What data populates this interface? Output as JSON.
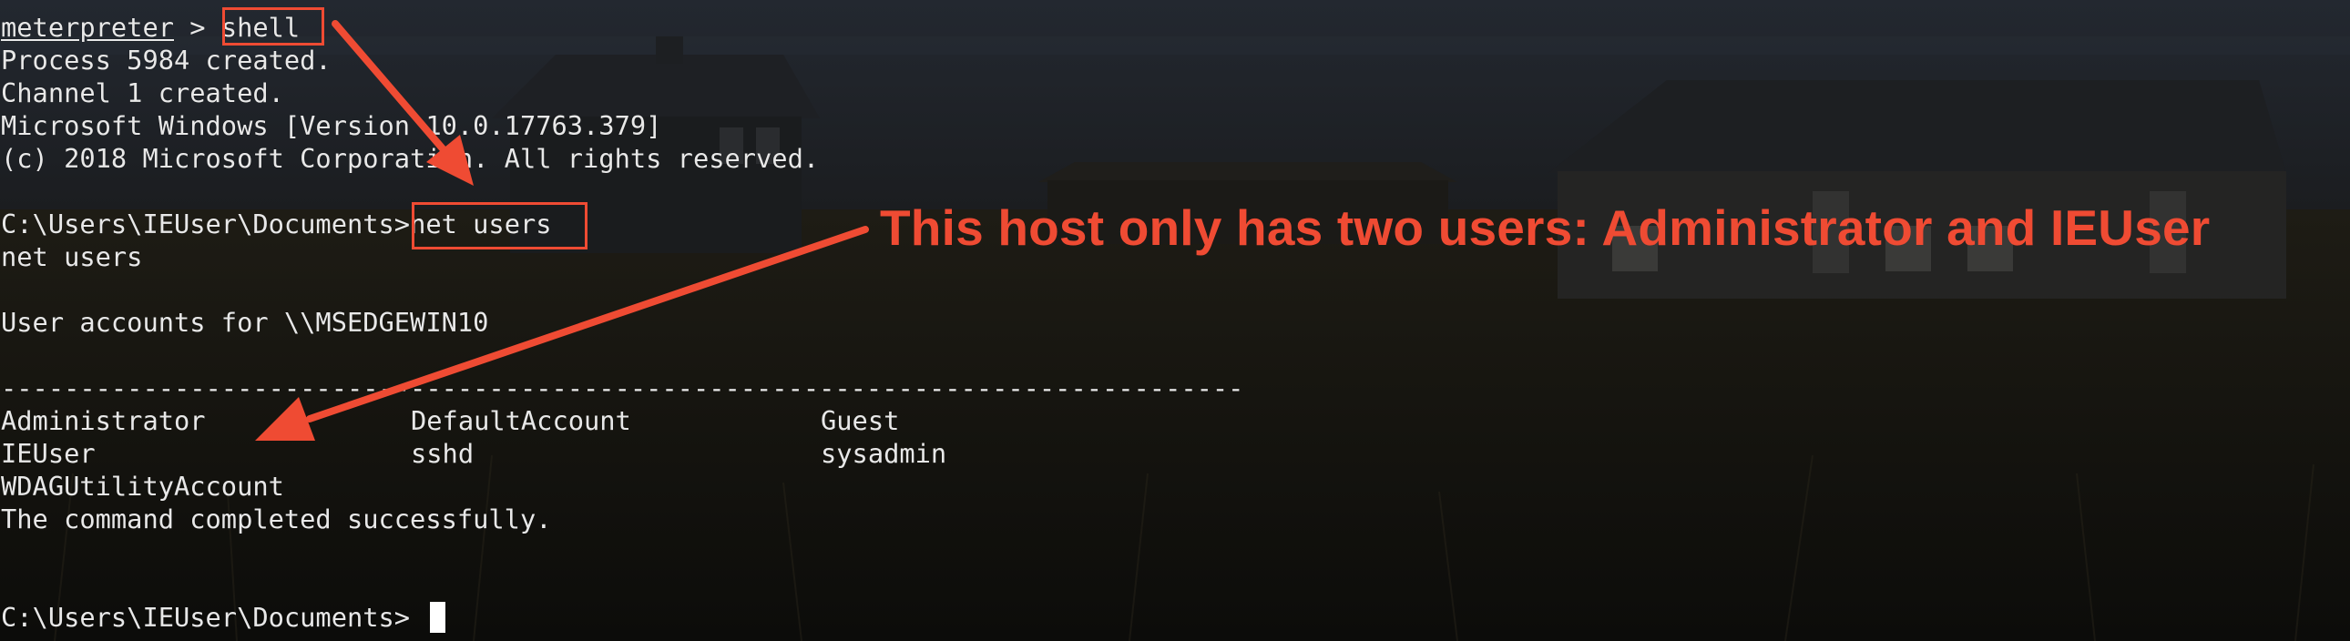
{
  "terminal": {
    "lines": {
      "prompt_word": "meterpreter",
      "prompt_sep": " > ",
      "command_shell": "shell",
      "process": "Process 5984 created.",
      "channel": "Channel 1 created.",
      "windows_version": "Microsoft Windows [Version 10.0.17763.379]",
      "copyright": "(c) 2018 Microsoft Corporation. All rights reserved.",
      "cwd_prompt": "C:\\Users\\IEUser\\Documents>",
      "command_net_users": "net users",
      "echo_net_users": "net users",
      "accounts_header": "User accounts for \\\\MSEDGEWIN10",
      "separator": "-------------------------------------------------------------------------------",
      "completed": "The command completed successfully.",
      "final_prompt": "C:\\Users\\IEUser\\Documents>"
    },
    "users": {
      "col1": [
        "Administrator",
        "IEUser",
        "WDAGUtilityAccount"
      ],
      "col2": [
        "DefaultAccount",
        "sshd"
      ],
      "col3": [
        "Guest",
        "sysadmin"
      ]
    }
  },
  "annotation": {
    "text": "This host only has two users: Administrator and IEUser",
    "color": "#ef4b33"
  },
  "highlights": {
    "color": "#ef4b33"
  }
}
